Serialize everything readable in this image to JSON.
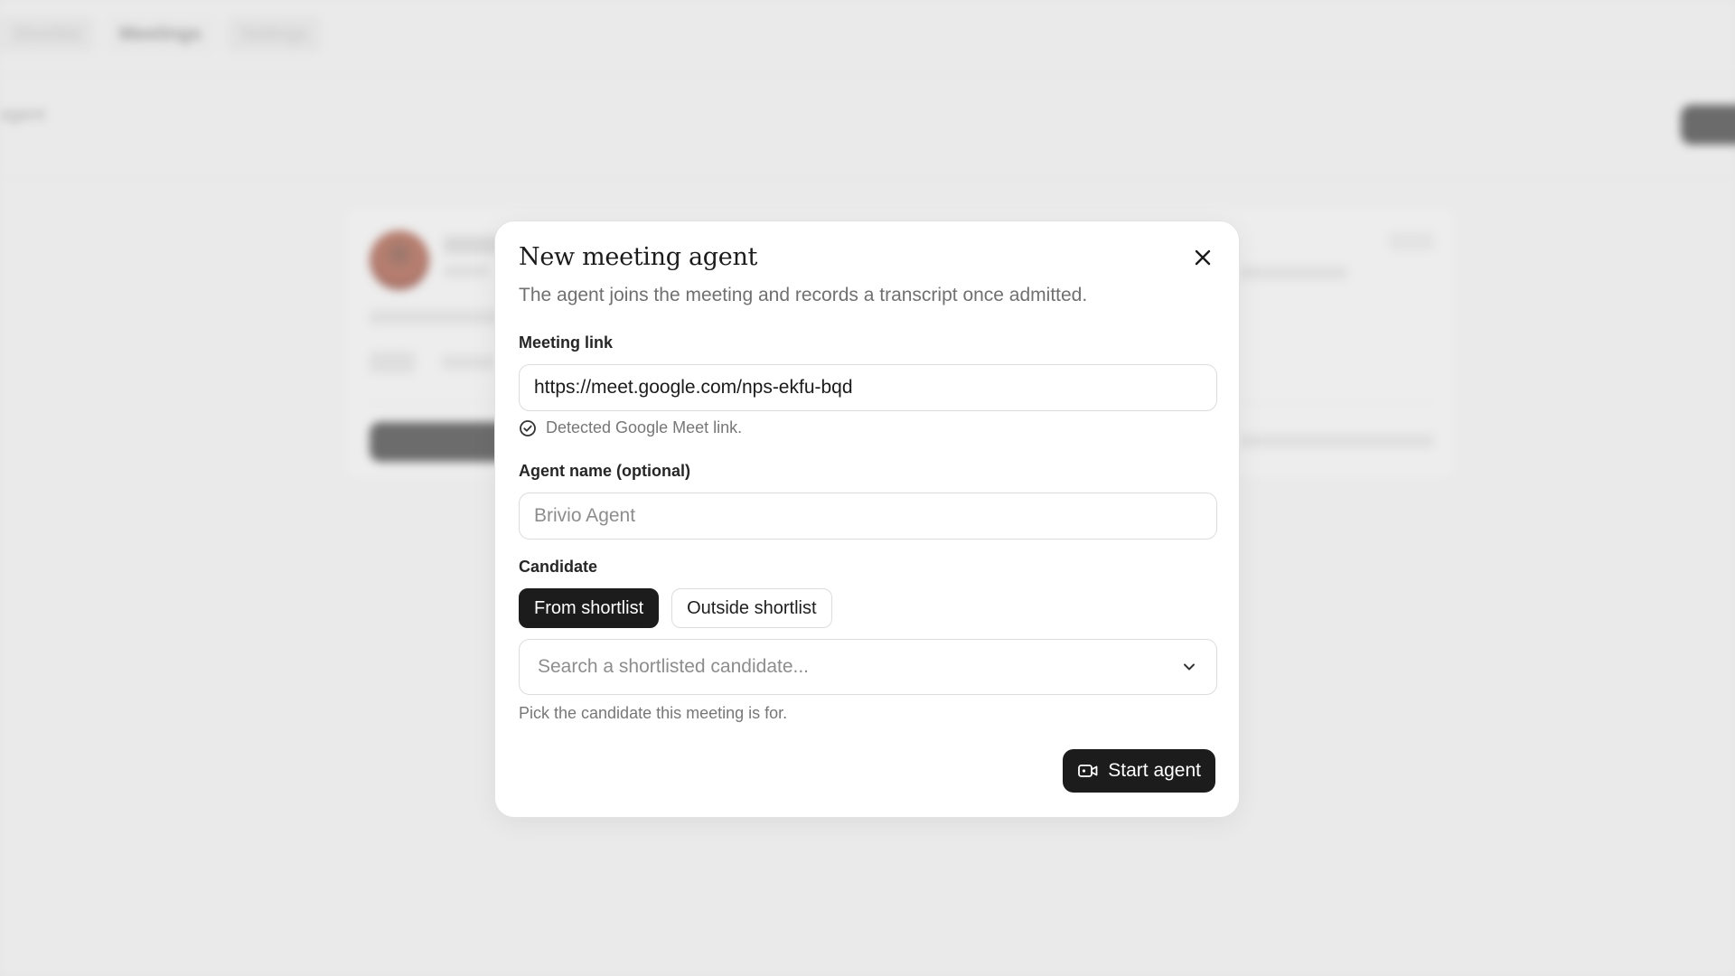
{
  "background": {
    "nav_tabs": [
      {
        "label": "Shortlist"
      },
      {
        "label": "Meetings"
      },
      {
        "label": "Settings"
      }
    ],
    "page_subtitle": "agent"
  },
  "modal": {
    "title": "New meeting agent",
    "subtitle": "The agent joins the meeting and records a transcript once admitted.",
    "meeting_link": {
      "label": "Meeting link",
      "value": "https://meet.google.com/nps-ekfu-bqd",
      "hint": "Detected Google Meet link."
    },
    "agent_name": {
      "label": "Agent name (optional)",
      "placeholder": "Brivio Agent"
    },
    "candidate": {
      "label": "Candidate",
      "options": [
        {
          "label": "From shortlist",
          "selected": true
        },
        {
          "label": "Outside shortlist",
          "selected": false
        }
      ],
      "search_placeholder": "Search a shortlisted candidate...",
      "help": "Pick the candidate this meeting is for."
    },
    "start_button": "Start agent"
  },
  "colors": {
    "primary_dark": "#1c1c1c",
    "text_muted": "#707070",
    "border": "#dcdcdc"
  },
  "icons": [
    "close-icon",
    "check-circle-icon",
    "chevron-down-icon",
    "video-camera-icon"
  ]
}
